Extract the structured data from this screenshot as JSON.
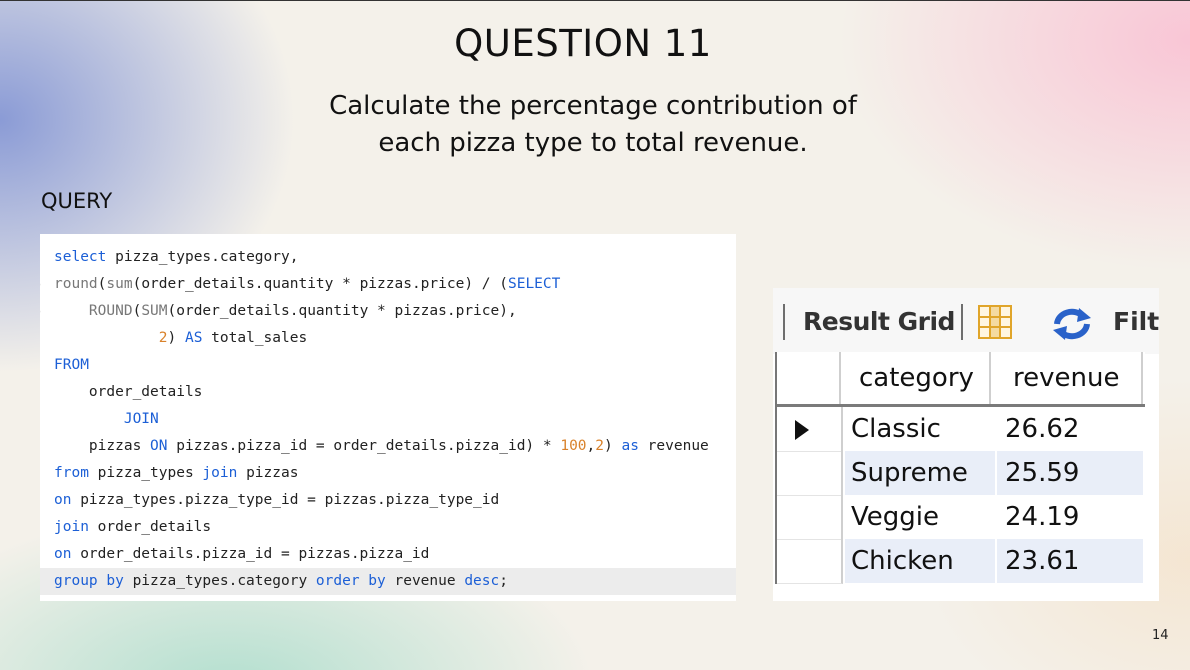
{
  "slide": {
    "title": "QUESTION 11",
    "subtitle_lines": [
      "Calculate the percentage contribution of",
      "each pizza type to total revenue."
    ],
    "query_label": "QUERY",
    "page_number": "14"
  },
  "code": {
    "lines": [
      {
        "gutter": "",
        "tokens": [
          [
            "kw",
            "select"
          ],
          [
            "t",
            " pizza_types.category,"
          ]
        ]
      },
      {
        "gutter": "⊖",
        "tokens": [
          [
            "fn",
            "round"
          ],
          [
            "t",
            "("
          ],
          [
            "fn",
            "sum"
          ],
          [
            "t",
            "(order_details.quantity * pizzas.price) / ("
          ],
          [
            "kw",
            "SELECT"
          ]
        ]
      },
      {
        "gutter": "⊖",
        "tokens": [
          [
            "t",
            "    "
          ],
          [
            "fn",
            "ROUND"
          ],
          [
            "t",
            "("
          ],
          [
            "fn",
            "SUM"
          ],
          [
            "t",
            "(order_details.quantity * pizzas.price),"
          ]
        ]
      },
      {
        "gutter": "-",
        "tokens": [
          [
            "t",
            "            "
          ],
          [
            "num",
            "2"
          ],
          [
            "t",
            ") "
          ],
          [
            "kw",
            "AS"
          ],
          [
            "t",
            " total_sales"
          ]
        ]
      },
      {
        "gutter": "",
        "tokens": [
          [
            "kw",
            "FROM"
          ]
        ]
      },
      {
        "gutter": "",
        "tokens": [
          [
            "t",
            "    order_details"
          ]
        ]
      },
      {
        "gutter": "",
        "tokens": [
          [
            "t",
            "        "
          ],
          [
            "kw",
            "JOIN"
          ]
        ]
      },
      {
        "gutter": "-",
        "tokens": [
          [
            "t",
            "    pizzas "
          ],
          [
            "kw",
            "ON"
          ],
          [
            "t",
            " pizzas.pizza_id = order_details.pizza_id) * "
          ],
          [
            "num",
            "100"
          ],
          [
            "t",
            ","
          ],
          [
            "num",
            "2"
          ],
          [
            "t",
            ") "
          ],
          [
            "kw",
            "as"
          ],
          [
            "t",
            " revenue"
          ]
        ]
      },
      {
        "gutter": "",
        "tokens": [
          [
            "kw",
            "from"
          ],
          [
            "t",
            " pizza_types "
          ],
          [
            "kw",
            "join"
          ],
          [
            "t",
            " pizzas"
          ]
        ]
      },
      {
        "gutter": "",
        "tokens": [
          [
            "kw",
            "on"
          ],
          [
            "t",
            " pizza_types.pizza_type_id = pizzas.pizza_type_id"
          ]
        ]
      },
      {
        "gutter": "",
        "tokens": [
          [
            "kw",
            "join"
          ],
          [
            "t",
            " order_details"
          ]
        ]
      },
      {
        "gutter": "",
        "tokens": [
          [
            "kw",
            "on"
          ],
          [
            "t",
            " order_details.pizza_id = pizzas.pizza_id"
          ]
        ]
      },
      {
        "gutter": "",
        "tokens": [
          [
            "kw",
            "group by"
          ],
          [
            "t",
            " pizza_types.category "
          ],
          [
            "kw",
            "order by"
          ],
          [
            "t",
            " revenue "
          ],
          [
            "kw",
            "desc"
          ],
          [
            "t",
            ";"
          ]
        ],
        "highlight": true
      }
    ]
  },
  "result": {
    "toolbar_label": "Result Grid",
    "filter_label": "Filte",
    "icons": [
      "grid-layout-icon",
      "refresh-icon"
    ],
    "columns": [
      "category",
      "revenue"
    ],
    "rows": [
      {
        "category": "Classic",
        "revenue": "26.62",
        "selected": true
      },
      {
        "category": "Supreme",
        "revenue": "25.59"
      },
      {
        "category": "Veggie",
        "revenue": "24.19"
      },
      {
        "category": "Chicken",
        "revenue": "23.61"
      }
    ]
  },
  "colors": {
    "keyword": "#1c5fd6",
    "function": "#777777",
    "number": "#d9822b",
    "alt_row": "#e9eef8",
    "refresh_icon": "#2a62c9",
    "grid_icon": "#e0a52a"
  }
}
